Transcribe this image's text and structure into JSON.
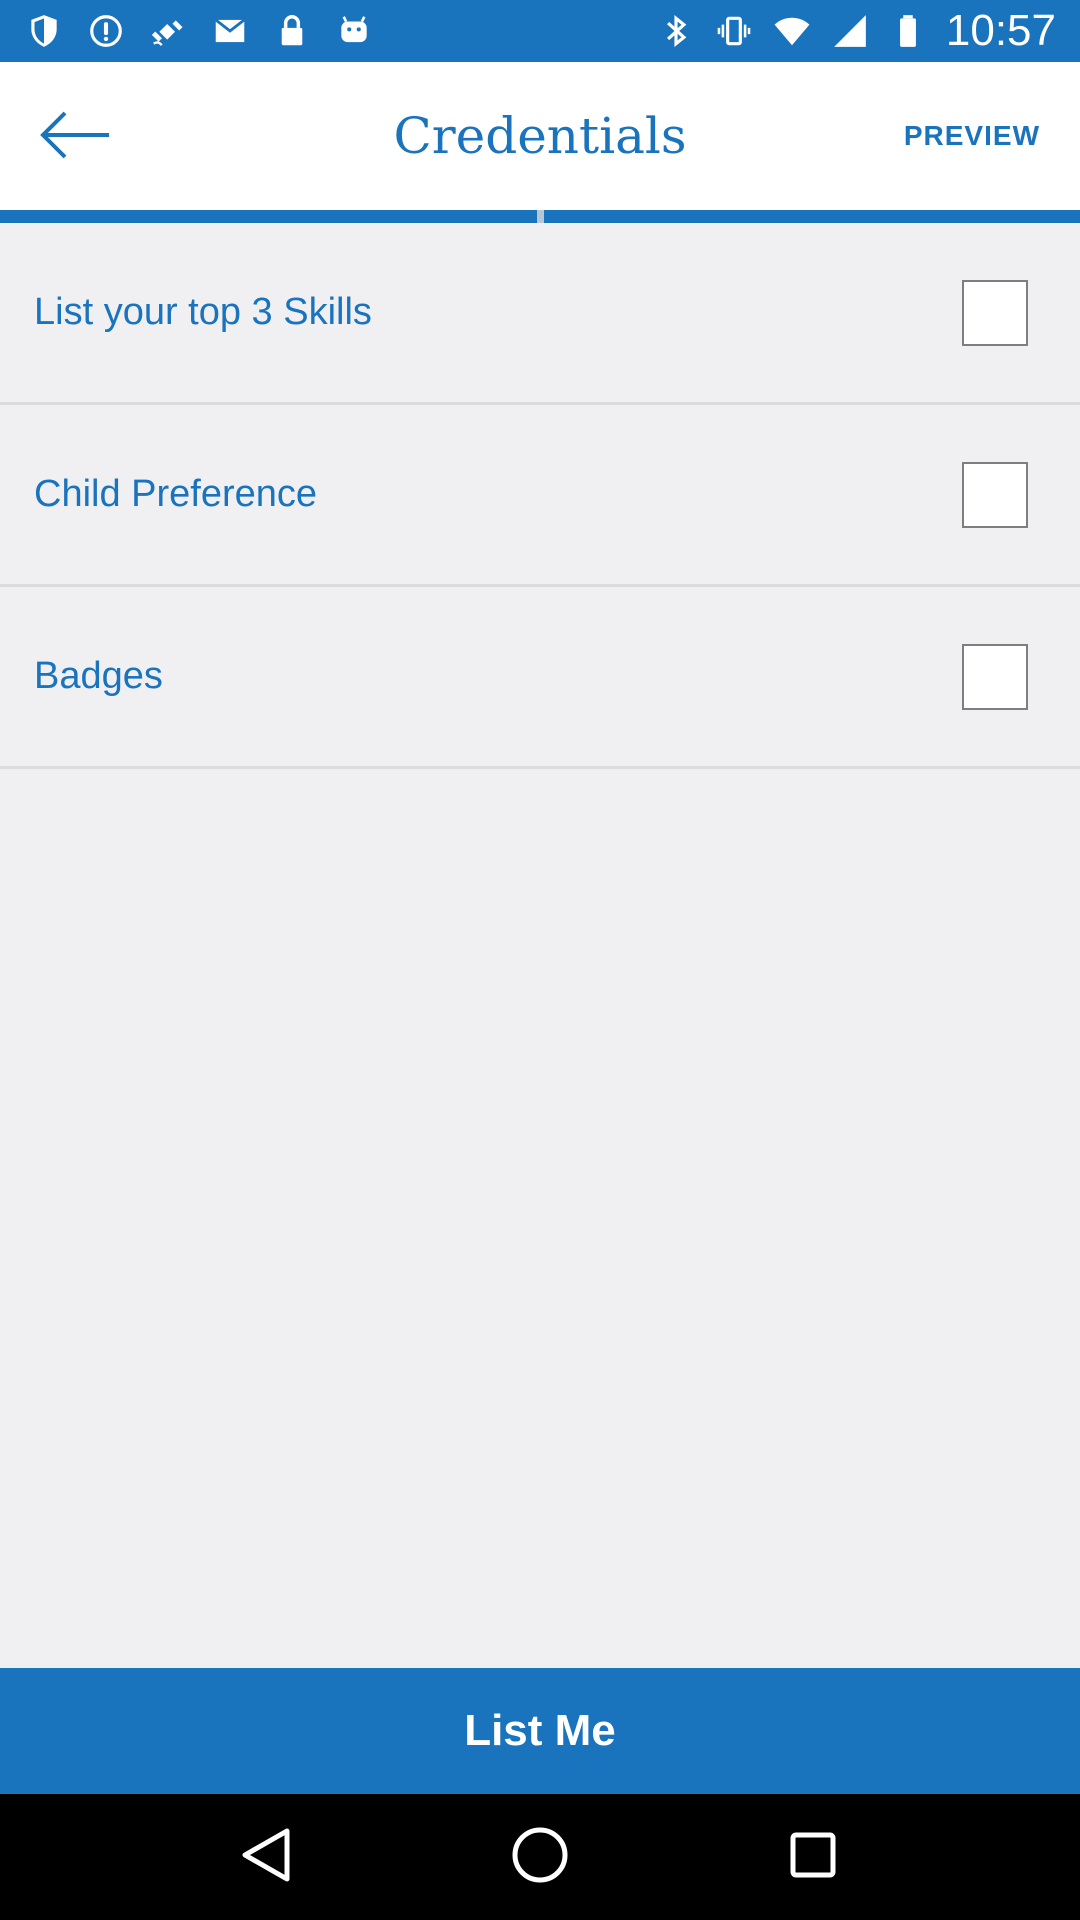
{
  "status_bar": {
    "time": "10:57",
    "left_icons": [
      "shield-icon",
      "alert-circle-icon",
      "fake-gps-icon",
      "email-icon",
      "lock-icon",
      "android-icon"
    ],
    "right_icons": [
      "bluetooth-icon",
      "vibrate-icon",
      "wifi-icon",
      "signal-icon",
      "battery-icon"
    ]
  },
  "app_bar": {
    "title": "Credentials",
    "action_label": "PREVIEW",
    "back_icon": "arrow-left-icon"
  },
  "progress": {
    "fraction": 0.5
  },
  "items": [
    {
      "label": "List your top 3 Skills",
      "checked": false
    },
    {
      "label": "Child Preference",
      "checked": false
    },
    {
      "label": "Badges",
      "checked": false
    }
  ],
  "primary_button": {
    "label": "List Me"
  },
  "nav_bar": {
    "buttons": [
      "back-triangle-icon",
      "home-circle-icon",
      "recents-square-icon"
    ]
  },
  "colors": {
    "accent": "#1a73bd",
    "background": "#f0f0f3",
    "surface": "#ffffff"
  }
}
